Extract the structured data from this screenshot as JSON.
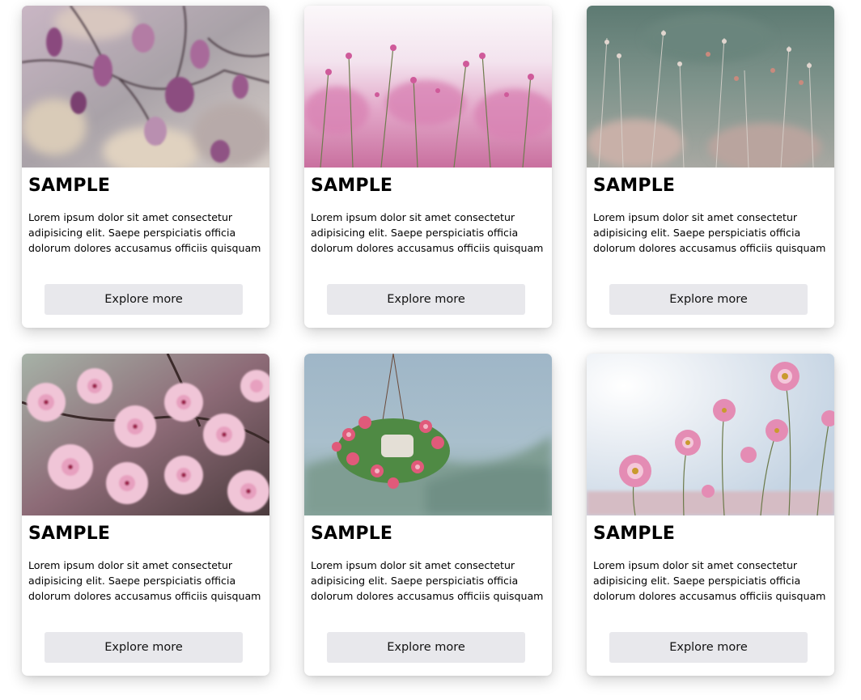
{
  "cards": [
    {
      "title": "SAMPLE",
      "text": "Lorem ipsum dolor sit amet consectetur adipisicing elit. Saepe perspiciatis officia dolorum dolores accusamus officiis quisquam",
      "button": "Explore more",
      "image": "magnolia-blossoms-photo"
    },
    {
      "title": "SAMPLE",
      "text": "Lorem ipsum dolor sit amet consectetur adipisicing elit. Saepe perspiciatis officia dolorum dolores accusamus officiis quisquam",
      "button": "Explore more",
      "image": "pink-grass-flowers-photo"
    },
    {
      "title": "SAMPLE",
      "text": "Lorem ipsum dolor sit amet consectetur adipisicing elit. Saepe perspiciatis officia dolorum dolores accusamus officiis quisquam",
      "button": "Explore more",
      "image": "wild-grass-photo"
    },
    {
      "title": "SAMPLE",
      "text": "Lorem ipsum dolor sit amet consectetur adipisicing elit. Saepe perspiciatis officia dolorum dolores accusamus officiis quisquam",
      "button": "Explore more",
      "image": "cherry-blossoms-photo"
    },
    {
      "title": "SAMPLE",
      "text": "Lorem ipsum dolor sit amet consectetur adipisicing elit. Saepe perspiciatis officia dolorum dolores accusamus officiis quisquam",
      "button": "Explore more",
      "image": "hanging-flower-basket-photo"
    },
    {
      "title": "SAMPLE",
      "text": "Lorem ipsum dolor sit amet consectetur adipisicing elit. Saepe perspiciatis officia dolorum dolores accusamus officiis quisquam",
      "button": "Explore more",
      "image": "cosmos-flowers-photo"
    }
  ],
  "colors": {
    "card_background": "#ffffff",
    "button_background": "#e8e8ec",
    "title_color": "#000000"
  }
}
